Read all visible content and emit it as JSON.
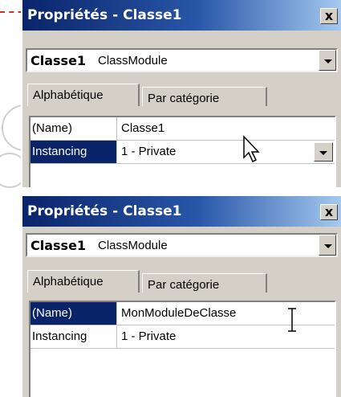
{
  "windows": [
    {
      "title": "Propriétés - Classe1",
      "close_label": "x",
      "object_combo": {
        "name": "Classe1",
        "type": "ClassModule"
      },
      "tabs": [
        {
          "label": "Alphabétique",
          "active": true
        },
        {
          "label": "Par catégorie",
          "active": false
        }
      ],
      "properties": [
        {
          "name": "(Name)",
          "value": "Classe1",
          "selected": false
        },
        {
          "name": "Instancing",
          "value": "1 - Private",
          "selected": true
        }
      ],
      "cursor": "arrow-cursor-icon"
    },
    {
      "title": "Propriétés - Classe1",
      "close_label": "x",
      "object_combo": {
        "name": "Classe1",
        "type": "ClassModule"
      },
      "tabs": [
        {
          "label": "Alphabétique",
          "active": true
        },
        {
          "label": "Par catégorie",
          "active": false
        }
      ],
      "properties": [
        {
          "name": "(Name)",
          "value": "MonModuleDeClasse",
          "selected": true
        },
        {
          "name": "Instancing",
          "value": "1 - Private",
          "selected": false
        }
      ],
      "cursor": "text-cursor-icon"
    }
  ],
  "colors": {
    "titlebar_start": "#0a246a",
    "titlebar_end": "#a6caf0",
    "selection": "#0a246a",
    "panel_bg": "#d4d0c8"
  }
}
